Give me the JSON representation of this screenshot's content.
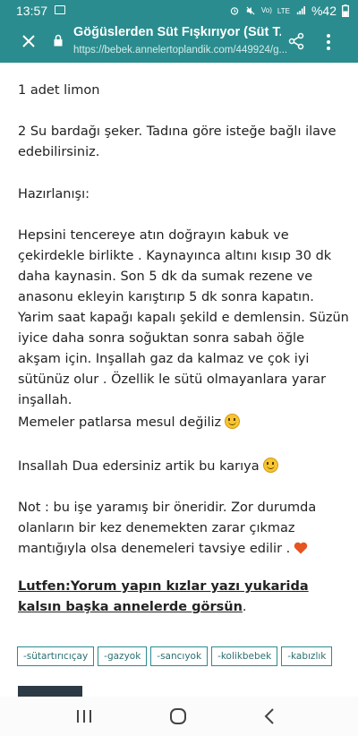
{
  "status": {
    "time": "13:57",
    "right_text": "%42",
    "lte": "LTE",
    "volte": "Vo)"
  },
  "toolbar": {
    "title": "Göğüslerden Süt Fışkırıyor (Süt T...",
    "url": "https://bebek.annelertoplandik.com/449924/g..."
  },
  "post": {
    "p1": "1 adet limon",
    "p2": "2 Su bardağı şeker.  Tadına göre isteğe bağlı ilave edebilirsiniz.",
    "p3": "Hazırlanışı:",
    "p4": "Hepsini tencereye atın doğrayın kabuk ve çekirdekle birlikte . Kaynayınca altını kısıp 30 dk daha kaynasin. Son 5 dk da sumak rezene ve anasonu ekleyin karıştırıp 5 dk sonra kapatın.  Yarim saat kapağı kapalı şekild e demlensin.  Süzün iyice daha sonra soğuktan sonra sabah öğle akşam için.  Inşallah gaz da kalmaz ve çok iyi sütünüz olur . Özellik le sütü olmayanlara yarar inşallah.",
    "p5": "Memeler patlarsa mesul değiliz",
    "p6": "Insallah Dua edersiniz artik bu karıya",
    "p7": "Not : bu işe yaramış bir öneridir.  Zor durumda olanların bir kez denemekten zarar çıkmaz mantığıyla olsa denemeleri tavsiye edilir .",
    "p8_link": "Lutfen:Yorum yapın kızlar yazı yukarida kalsın başka annelerde görsün",
    "p8_end": "."
  },
  "tags": [
    "-sütartırıcıçay",
    "-gazyok",
    "-sancıyok",
    "-kolikbebek",
    "-kabızlık"
  ],
  "icons": {
    "emoji": "smiley-emoji-icon",
    "heart": "heart-emoji-icon",
    "close": "close-icon",
    "lock": "lock-icon",
    "share": "share-icon",
    "more": "more-vertical-icon",
    "recent": "recent-apps-icon",
    "home": "home-icon",
    "back": "back-icon"
  },
  "colors": {
    "toolbar": "#2a8c8e",
    "tag_border": "#2a8c8e",
    "heart": "#e8531f",
    "emoji": "#f6c531"
  }
}
